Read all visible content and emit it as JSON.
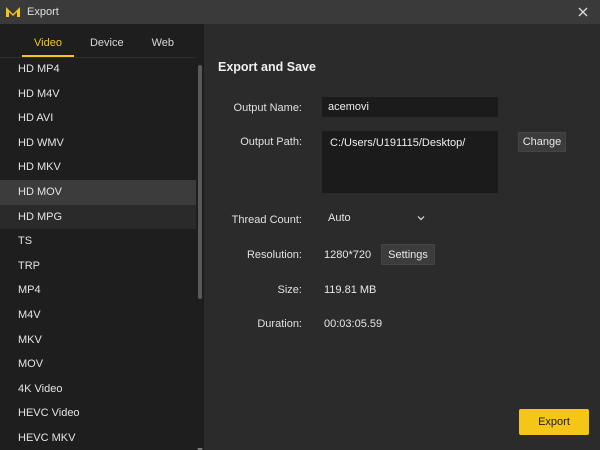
{
  "window": {
    "title": "Export",
    "accent_color": "#f5c518"
  },
  "tabs": [
    {
      "label": "Video",
      "active": true
    },
    {
      "label": "Device",
      "active": false
    },
    {
      "label": "Web",
      "active": false
    }
  ],
  "formats": [
    {
      "label": "HD MP4"
    },
    {
      "label": "HD M4V"
    },
    {
      "label": "HD AVI"
    },
    {
      "label": "HD WMV"
    },
    {
      "label": "HD MKV"
    },
    {
      "label": "HD MOV",
      "selected": true
    },
    {
      "label": "HD MPG"
    },
    {
      "label": "TS"
    },
    {
      "label": "TRP"
    },
    {
      "label": "MP4"
    },
    {
      "label": "M4V"
    },
    {
      "label": "MKV"
    },
    {
      "label": "MOV"
    },
    {
      "label": "4K Video"
    },
    {
      "label": "HEVC Video"
    },
    {
      "label": "HEVC MKV"
    }
  ],
  "export_panel": {
    "section_title": "Export and Save",
    "output_name_label": "Output Name:",
    "output_name_value": "acemovi",
    "output_path_label": "Output Path:",
    "output_path_value": "C:/Users/U191115/Desktop/",
    "change_button": "Change",
    "thread_count_label": "Thread Count:",
    "thread_count_value": "Auto",
    "resolution_label": "Resolution:",
    "resolution_value": "1280*720",
    "settings_button": "Settings",
    "size_label": "Size:",
    "size_value": "119.81 MB",
    "duration_label": "Duration:",
    "duration_value": "00:03:05.59",
    "export_button": "Export"
  }
}
